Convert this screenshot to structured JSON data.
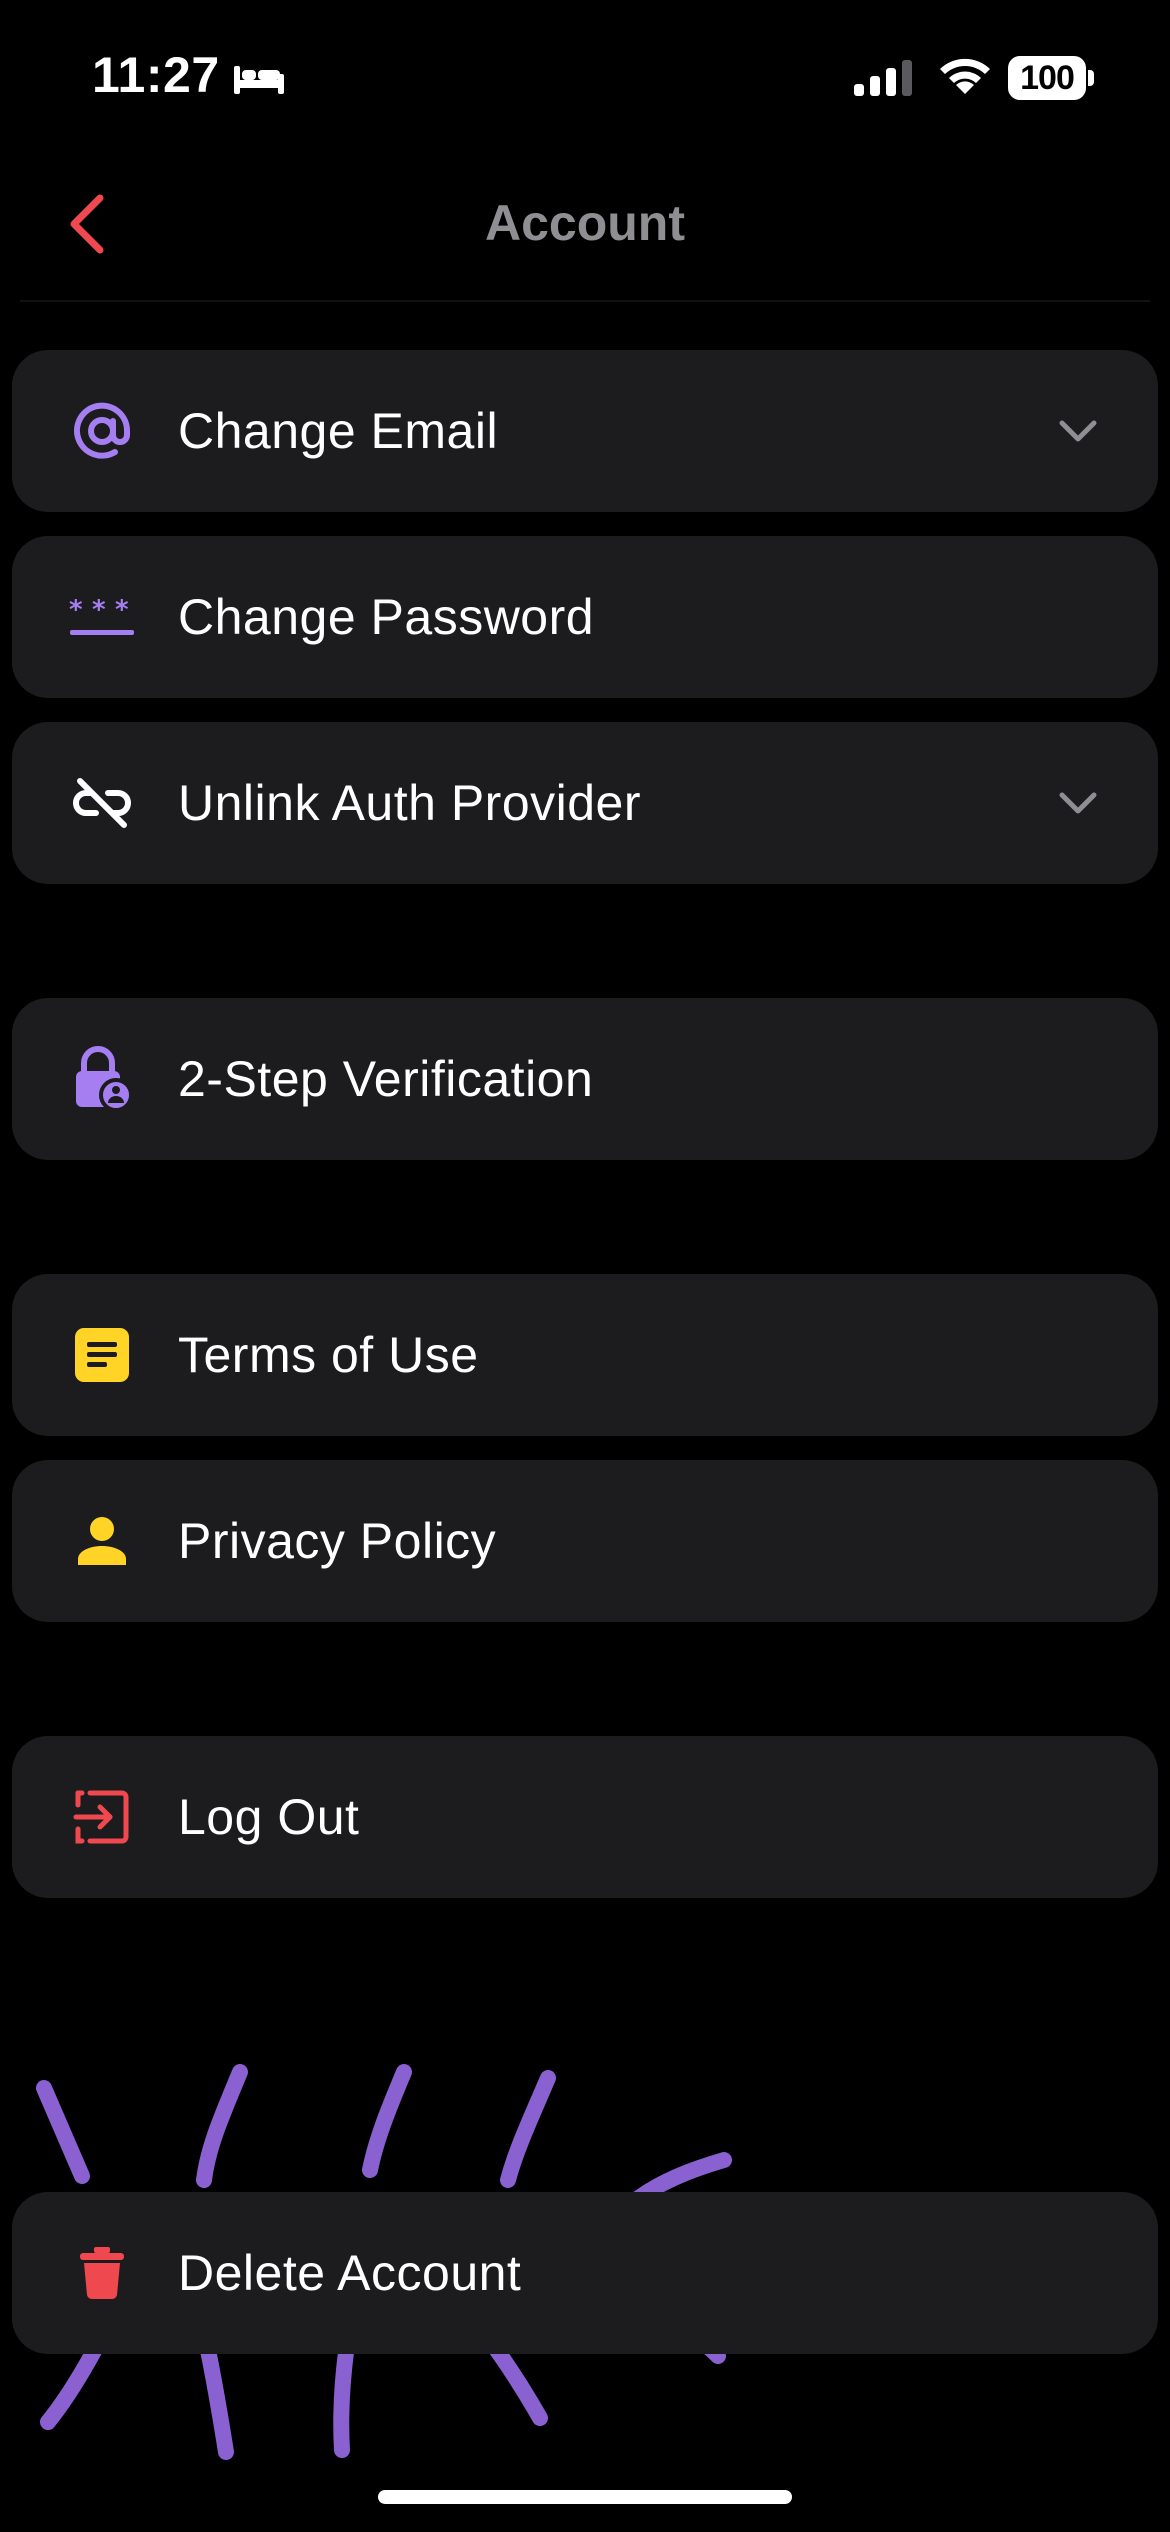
{
  "status_bar": {
    "time": "11:27",
    "battery": "100"
  },
  "nav": {
    "title": "Account"
  },
  "colors": {
    "accent_purple": "#a57ff2",
    "accent_yellow": "#ffd426",
    "accent_red": "#f0484f",
    "row_bg": "#1c1c1e"
  },
  "rows": [
    {
      "label": "Change Email",
      "icon": "at-sign-icon",
      "has_chevron": true
    },
    {
      "label": "Change Password",
      "icon": "password-asterisks-icon",
      "has_chevron": false
    },
    {
      "label": "Unlink Auth Provider",
      "icon": "unlink-icon",
      "has_chevron": true
    },
    {
      "label": "2-Step Verification",
      "icon": "lock-user-icon",
      "has_chevron": false
    },
    {
      "label": "Terms of Use",
      "icon": "document-icon",
      "has_chevron": false
    },
    {
      "label": "Privacy Policy",
      "icon": "person-icon",
      "has_chevron": false
    },
    {
      "label": "Log Out",
      "icon": "logout-icon",
      "has_chevron": false
    },
    {
      "label": "Delete Account",
      "icon": "trash-icon",
      "has_chevron": false
    }
  ]
}
